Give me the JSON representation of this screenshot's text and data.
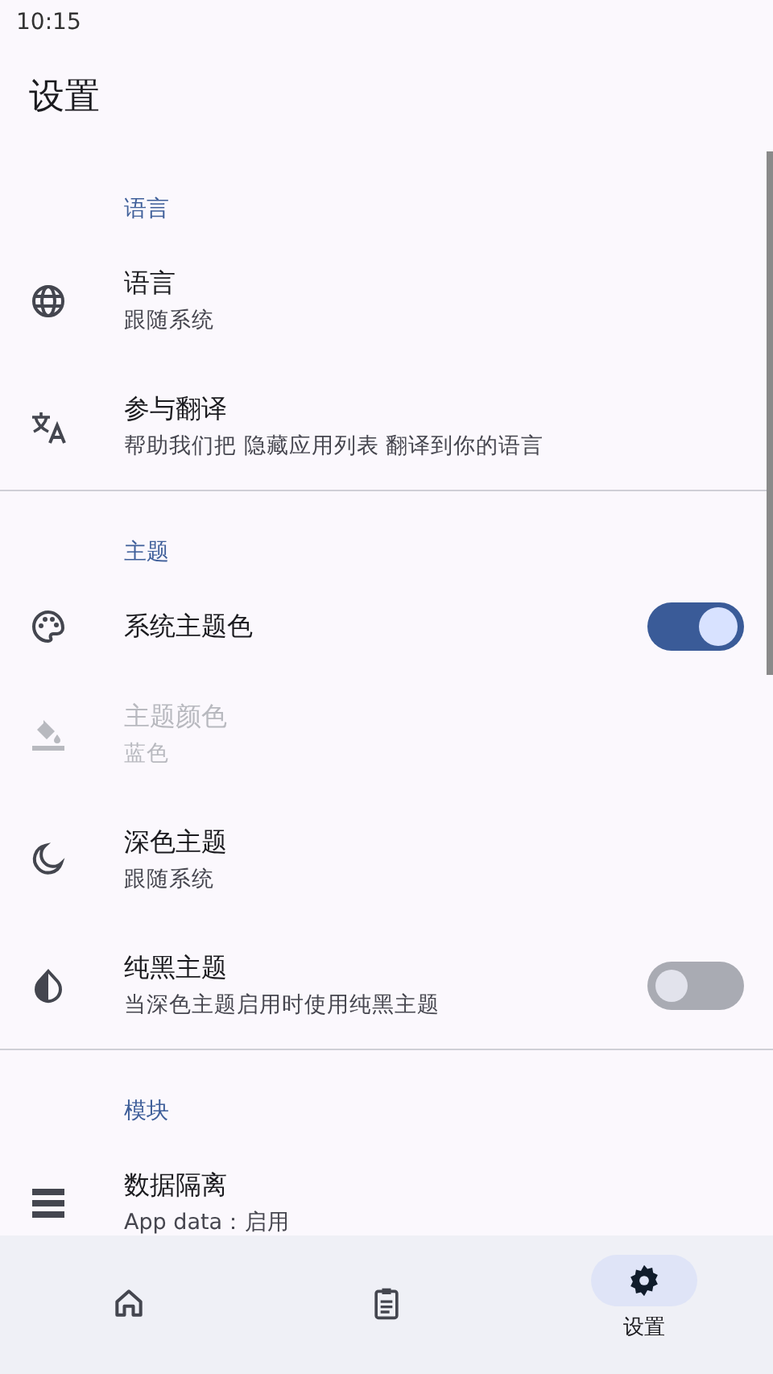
{
  "status_bar": {
    "time": "10:15"
  },
  "title": "设置",
  "sections": [
    {
      "title": "语言",
      "items": [
        {
          "kind": "plain",
          "title": "语言",
          "subtitle": "跟随系统",
          "disabled": false
        },
        {
          "kind": "plain",
          "title": "参与翻译",
          "subtitle": "帮助我们把 隐藏应用列表 翻译到你的语言",
          "disabled": false
        }
      ]
    },
    {
      "title": "主题",
      "items": [
        {
          "kind": "switch",
          "title": "系统主题色",
          "on": true,
          "disabled": false
        },
        {
          "kind": "plain",
          "title": "主题颜色",
          "subtitle": "蓝色",
          "disabled": true
        },
        {
          "kind": "plain",
          "title": "深色主题",
          "subtitle": "跟随系统",
          "disabled": false
        },
        {
          "kind": "switch",
          "title": "纯黑主题",
          "subtitle": "当深色主题启用时使用纯黑主题",
          "on": false,
          "disabled": false
        }
      ]
    },
    {
      "title": "模块",
      "items": [
        {
          "kind": "plain",
          "title": "数据隔离",
          "subtitle": "App data：启用",
          "disabled": false
        }
      ]
    }
  ],
  "nav": [
    {
      "selected": false
    },
    {
      "selected": false
    },
    {
      "selected": true,
      "label": "设置"
    }
  ]
}
